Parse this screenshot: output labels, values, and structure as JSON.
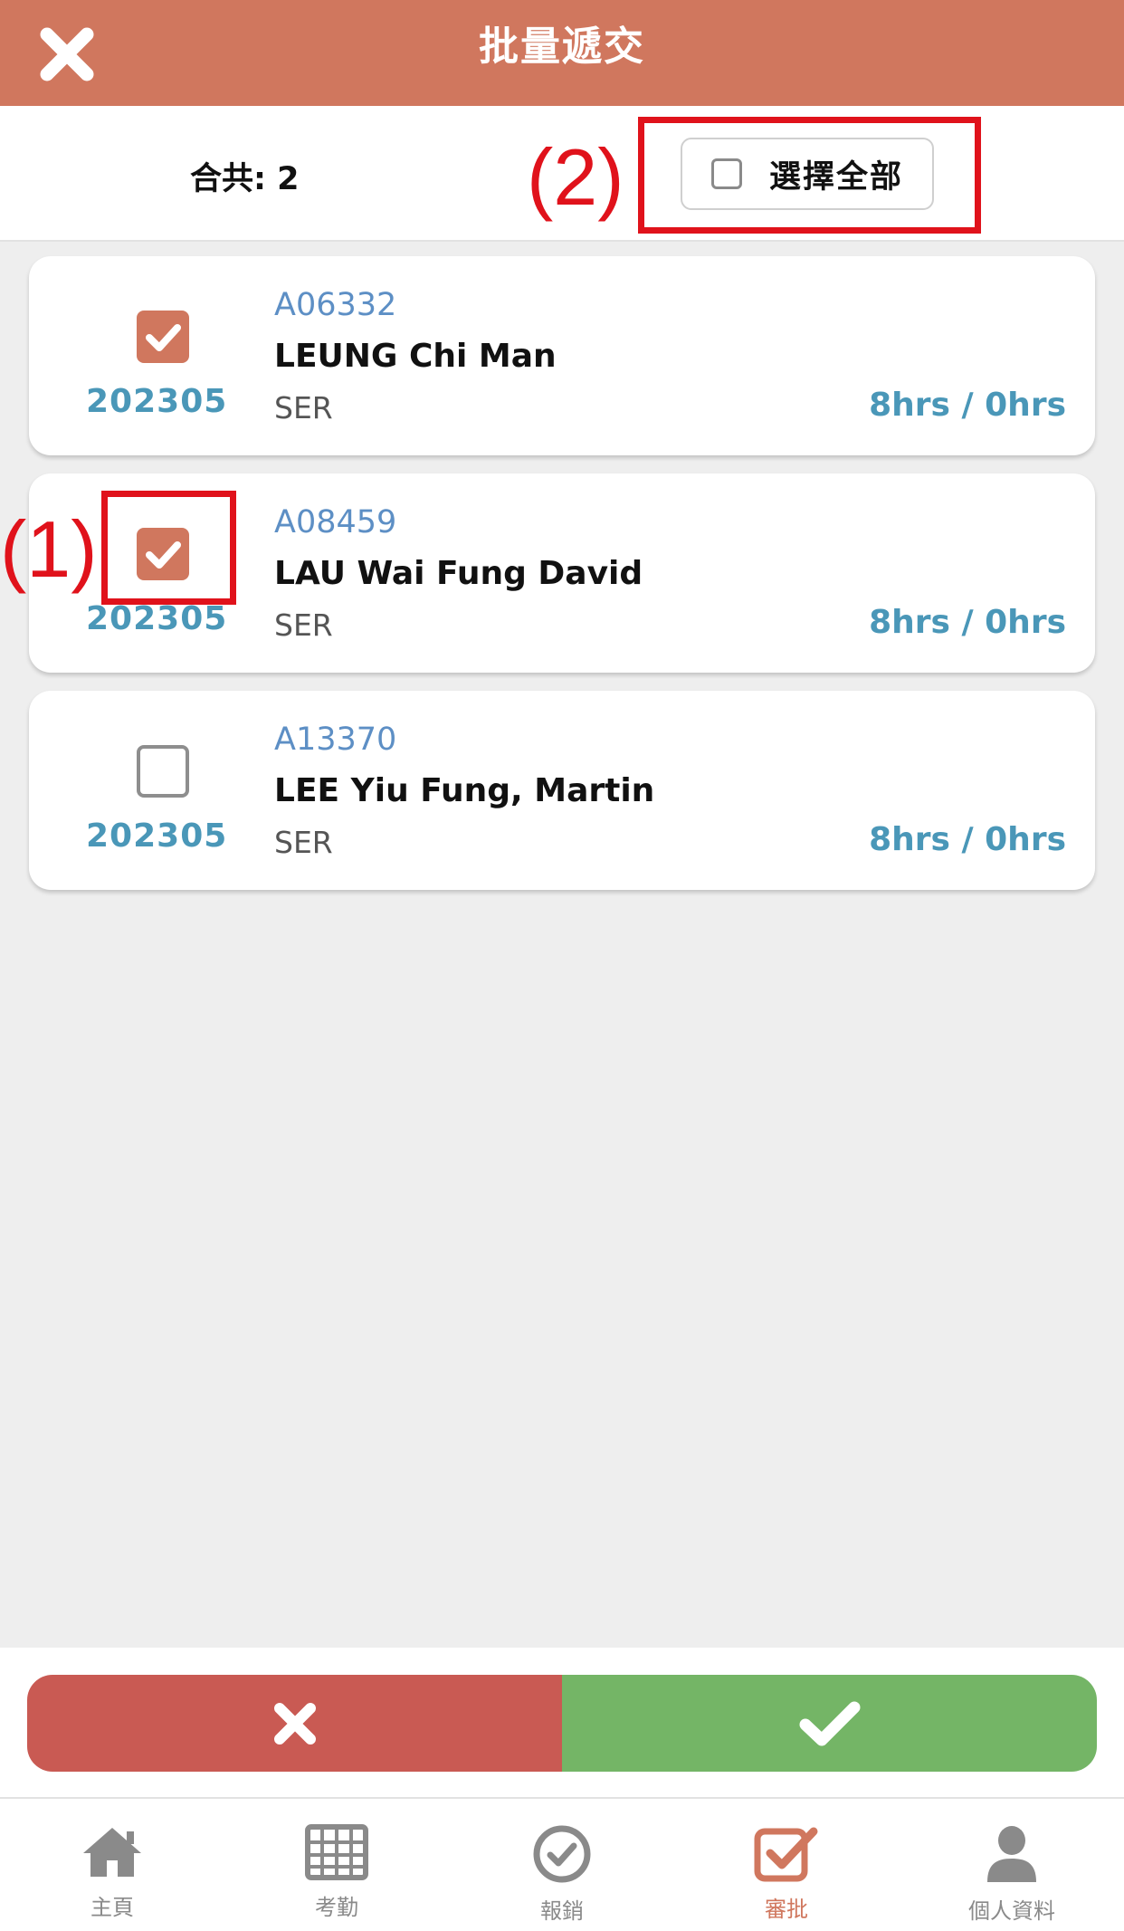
{
  "header": {
    "title": "批量遞交",
    "close_icon": "close-icon"
  },
  "summary": {
    "total_label": "合共: 2",
    "select_all_label": "選擇全部",
    "select_all_checked": false
  },
  "annotations": {
    "one": "(1)",
    "two": "(2)"
  },
  "records": [
    {
      "checked": true,
      "period": "202305",
      "code": "A06332",
      "name": "LEUNG Chi Man",
      "dept": "SER",
      "hours": "8hrs / 0hrs"
    },
    {
      "checked": true,
      "period": "202305",
      "code": "A08459",
      "name": "LAU Wai Fung David",
      "dept": "SER",
      "hours": "8hrs / 0hrs"
    },
    {
      "checked": false,
      "period": "202305",
      "code": "A13370",
      "name": "LEE Yiu Fung, Martin",
      "dept": "SER",
      "hours": "8hrs / 0hrs"
    }
  ],
  "actions": {
    "reject_icon": "close-icon",
    "approve_icon": "check-icon"
  },
  "tabs": [
    {
      "label": "主頁",
      "icon": "home-icon",
      "active": false
    },
    {
      "label": "考勤",
      "icon": "calendar-grid-icon",
      "active": false
    },
    {
      "label": "報銷",
      "icon": "check-circle-icon",
      "active": false
    },
    {
      "label": "審批",
      "icon": "checkbox-checked-icon",
      "active": true
    },
    {
      "label": "個人資料",
      "icon": "user-icon",
      "active": false
    }
  ],
  "colors": {
    "brand": "#d0775e",
    "accent_blue": "#4a97b8",
    "reject": "#c95a53",
    "approve": "#74b566",
    "annotation": "#e0121b"
  }
}
